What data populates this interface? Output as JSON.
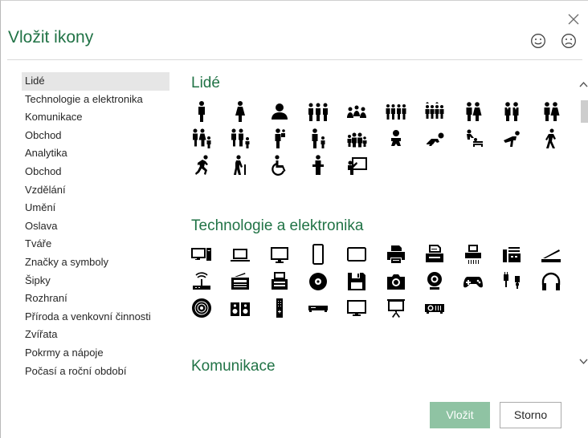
{
  "dialog": {
    "title": "Vložit ikony",
    "close_icon": "close-icon",
    "feedback_icons": [
      "smile-icon",
      "frown-icon"
    ]
  },
  "categories": [
    "Lidé",
    "Technologie a elektronika",
    "Komunikace",
    "Obchod",
    "Analytika",
    "Obchod",
    "Vzdělání",
    "Umění",
    "Oslava",
    "Tváře",
    "Značky a symboly",
    "Šipky",
    "Rozhraní",
    "Příroda a venkovní činnosti",
    "Zvířata",
    "Pokrmy a nápoje",
    "Počasí a roční období"
  ],
  "selected_category": "Lidé",
  "sections": [
    {
      "title": "Lidé",
      "icons": [
        "man-icon",
        "woman-icon",
        "user-icon",
        "group-of-three-icon",
        "meeting-group-icon",
        "four-people-icon",
        "crowd-icon",
        "couple-icon",
        "couple-formal-icon",
        "man-and-woman-icon",
        "family-icon",
        "family-with-child-icon",
        "parent-with-child-icon",
        "parent-walking-child-icon",
        "family-of-four-icon",
        "baby-icon",
        "crawling-baby-icon",
        "changing-table-icon",
        "stretching-person-icon",
        "walking-person-icon",
        "running-person-icon",
        "elderly-person-icon",
        "wheelchair-icon",
        "speaker-podium-icon",
        "presenter-board-icon"
      ]
    },
    {
      "title": "Technologie a elektronika",
      "icons": [
        "desktop-computer-icon",
        "laptop-icon",
        "monitor-icon",
        "smartphone-icon",
        "tablet-icon",
        "printer-icon",
        "printer-document-icon",
        "shredder-icon",
        "fax-machine-icon",
        "scanner-icon",
        "wireless-router-icon",
        "radio-icon",
        "typewriter-icon",
        "cd-icon",
        "floppy-disk-icon",
        "camera-icon",
        "webcam-icon",
        "game-controller-icon",
        "plug-icon",
        "headphones-icon",
        "vinyl-record-icon",
        "speakers-icon",
        "remote-control-icon",
        "dvd-player-icon",
        "tv-icon",
        "projector-screen-icon",
        "projector-icon"
      ]
    },
    {
      "title": "Komunikace",
      "icons": []
    }
  ],
  "buttons": {
    "insert": "Vložit",
    "cancel": "Storno"
  },
  "colors": {
    "title_accent": "#217346",
    "insert_button_disabled": "#8fc3a3",
    "selected_category_bg": "#e6e6e6"
  }
}
